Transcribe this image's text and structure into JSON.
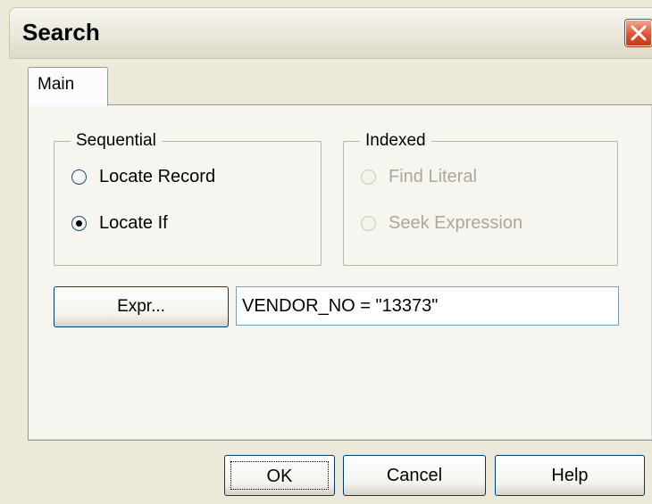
{
  "window": {
    "title": "Search",
    "close_icon": "close-icon",
    "accent": "#e2532f"
  },
  "tabs": [
    {
      "label": "Main",
      "active": true
    }
  ],
  "sequential": {
    "legend": "Sequential",
    "options": [
      {
        "label": "Locate Record",
        "checked": false,
        "enabled": true
      },
      {
        "label": "Locate If",
        "checked": true,
        "enabled": true
      }
    ]
  },
  "indexed": {
    "legend": "Indexed",
    "options": [
      {
        "label": "Find Literal",
        "checked": false,
        "enabled": false
      },
      {
        "label": "Seek Expression",
        "checked": false,
        "enabled": false
      }
    ]
  },
  "expression": {
    "button_label": "Expr...",
    "value": "VENDOR_NO = \"13373\""
  },
  "buttons": {
    "ok": "OK",
    "cancel": "Cancel",
    "help": "Help"
  }
}
